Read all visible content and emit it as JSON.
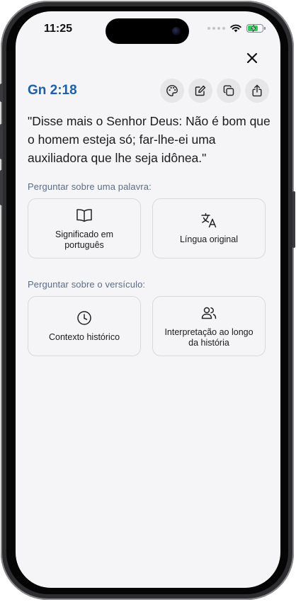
{
  "status_bar": {
    "time": "11:25"
  },
  "header": {
    "verse_reference": "Gn 2:18"
  },
  "toolbar": {
    "buttons": [
      {
        "icon": "palette-icon"
      },
      {
        "icon": "edit-icon"
      },
      {
        "icon": "copy-icon"
      },
      {
        "icon": "share-icon"
      }
    ],
    "close_icon": "close-icon"
  },
  "verse": {
    "text": "\"Disse mais o Senhor Deus: Não é bom que o homem esteja só; far-lhe-ei uma auxiliadora que lhe seja idônea.\""
  },
  "word_section": {
    "title": "Perguntar sobre uma palavra:",
    "cards": [
      {
        "label": "Significado em português",
        "icon": "book-open-icon"
      },
      {
        "label": "Língua original",
        "icon": "translate-icon"
      }
    ]
  },
  "verse_section": {
    "title": "Perguntar sobre o versículo:",
    "cards": [
      {
        "label": "Contexto histórico",
        "icon": "clock-icon"
      },
      {
        "label": "Interpretação ao longo da história",
        "icon": "users-icon"
      }
    ]
  },
  "colors": {
    "accent": "#1d5fa8",
    "background": "#f5f5f7",
    "section_label": "#5a6d86",
    "battery": "#34c759"
  }
}
